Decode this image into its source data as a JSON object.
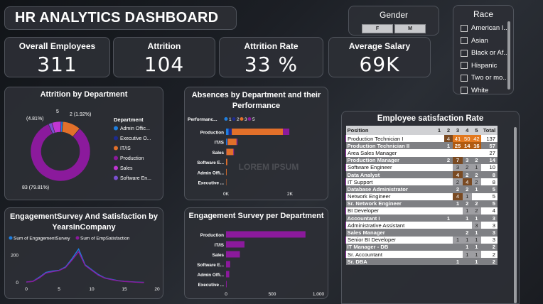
{
  "header": {
    "title": "HR ANALYTICS DASHBOARD"
  },
  "kpis": [
    {
      "label": "Overall Employees",
      "value": "311"
    },
    {
      "label": "Attrition",
      "value": "104"
    },
    {
      "label": "Attrition Rate",
      "value": "33 %"
    },
    {
      "label": "Average Salary",
      "value": "69K"
    }
  ],
  "gender": {
    "title": "Gender",
    "options": [
      "F",
      "M"
    ]
  },
  "race": {
    "title": "Race",
    "options": [
      "American I..",
      "Asian",
      "Black or Af..",
      "Hispanic",
      "Two or mo..",
      "White"
    ]
  },
  "watermark": "LOREM IPSUM",
  "colors": {
    "purple": "#8b1a9c",
    "orange": "#e2702a",
    "blue": "#1f7fe0",
    "darkblue": "#1d2b8f",
    "panel": "#2c2f35",
    "accent_magenta": "#c036d3"
  },
  "chart_data": [
    {
      "type": "pie",
      "title": "Attrition by Department",
      "legend_title": "Department",
      "legend_position": "right",
      "slices": [
        {
          "name": "Admin Offic...",
          "value": 1,
          "color": "#1f7fe0"
        },
        {
          "name": "Executive O...",
          "value": 0,
          "color": "#1d2b8f"
        },
        {
          "name": "IT/IS",
          "value": 10,
          "color": "#e2702a"
        },
        {
          "name": "Production",
          "value": 83,
          "color": "#8b1a9c"
        },
        {
          "name": "Sales",
          "value": 5,
          "color": "#c036d3"
        },
        {
          "name": "Software En...",
          "value": 2,
          "color": "#7b4fd0"
        }
      ],
      "data_labels": [
        "2 (1.92%)",
        "5",
        "(4.81%)",
        "83 (79.81%)"
      ]
    },
    {
      "type": "bar",
      "orientation": "horizontal",
      "title": "Absences by Department and their Performance",
      "legend_title": "Performanc...",
      "legend_position": "top",
      "categories": [
        "Production",
        "IT/IS",
        "Sales",
        "Software E...",
        "Admin Offi...",
        "Executive ..."
      ],
      "series": [
        {
          "name": "1",
          "color": "#1f7fe0",
          "values": [
            80,
            30,
            0,
            0,
            0,
            0
          ]
        },
        {
          "name": "2",
          "color": "#1d2b8f",
          "values": [
            100,
            20,
            10,
            0,
            0,
            0
          ]
        },
        {
          "name": "3",
          "color": "#e2702a",
          "values": [
            1600,
            280,
            220,
            40,
            20,
            10
          ]
        },
        {
          "name": "5",
          "color": "#8b1a9c",
          "values": [
            200,
            30,
            20,
            0,
            0,
            0
          ]
        }
      ],
      "xticks": [
        "0K",
        "2K"
      ],
      "xlim": [
        0,
        2600
      ]
    },
    {
      "type": "line",
      "title": "EngagementSurvey And Satisfaction by YearsInCompany",
      "legend_position": "top-left",
      "x": [
        0,
        1,
        2,
        3,
        4,
        5,
        6,
        7,
        8,
        9,
        10,
        11,
        12,
        13,
        14,
        15,
        16,
        17,
        18
      ],
      "series": [
        {
          "name": "Sum of EngagementSurvey",
          "color": "#1f7fe0",
          "values": [
            5,
            10,
            40,
            75,
            85,
            90,
            115,
            175,
            245,
            130,
            95,
            60,
            35,
            25,
            15,
            10,
            7,
            4,
            2
          ]
        },
        {
          "name": "Sum of EmpSatisfaction",
          "color": "#8b1a9c",
          "values": [
            5,
            9,
            35,
            70,
            80,
            88,
            110,
            165,
            225,
            125,
            90,
            55,
            33,
            22,
            14,
            9,
            6,
            3,
            2
          ]
        }
      ],
      "xticks": [
        0,
        5,
        10,
        15,
        20
      ],
      "yticks": [
        0,
        200
      ],
      "xlim": [
        0,
        20
      ],
      "ylim": [
        0,
        300
      ]
    },
    {
      "type": "bar",
      "orientation": "horizontal",
      "title": "Engagement Survey per Department",
      "categories": [
        "Production",
        "IT/IS",
        "Sales",
        "Software E...",
        "Admin Offi...",
        "Executive ..."
      ],
      "values": [
        860,
        200,
        150,
        45,
        35,
        5
      ],
      "color": "#8b1a9c",
      "xticks": [
        "0",
        "500",
        "1,000"
      ],
      "xlim": [
        0,
        1000
      ]
    },
    {
      "type": "table",
      "title": "Employee satisfaction Rate",
      "columns": [
        "Position",
        "1",
        "2",
        "3",
        "4",
        "5",
        "Total"
      ],
      "rows": [
        {
          "position": "Production Technician I",
          "cells": [
            "",
            "",
            "4",
            "41",
            "50",
            "42"
          ],
          "total": "137",
          "style": "a"
        },
        {
          "position": "Production Technician II",
          "cells": [
            "",
            "",
            "1",
            "25",
            "14",
            "16"
          ],
          "total": "57",
          "style": "b"
        },
        {
          "position": "Area Sales Manager",
          "cells": [
            "",
            "",
            "",
            "",
            "",
            ""
          ],
          "total": "27",
          "style": "a"
        },
        {
          "position": "Production Manager",
          "cells": [
            "",
            "",
            "2",
            "7",
            "3",
            "2"
          ],
          "total": "14",
          "style": "b"
        },
        {
          "position": "Software Engineer",
          "cells": [
            "",
            "",
            "",
            "3",
            "2",
            "1"
          ],
          "total": "10",
          "style": "a"
        },
        {
          "position": "Data Analyst",
          "cells": [
            "",
            "",
            "",
            "4",
            "2",
            "2"
          ],
          "total": "8",
          "style": "b"
        },
        {
          "position": "IT Support",
          "cells": [
            "",
            "",
            "",
            "2",
            "4",
            "2"
          ],
          "total": "8",
          "style": "a"
        },
        {
          "position": "Database Administrator",
          "cells": [
            "",
            "",
            "",
            "2",
            "2",
            "1"
          ],
          "total": "5",
          "style": "b"
        },
        {
          "position": "Network Engineer",
          "cells": [
            "",
            "",
            "",
            "4",
            "1",
            ""
          ],
          "total": "5",
          "style": "a"
        },
        {
          "position": "Sr. Network Engineer",
          "cells": [
            "",
            "",
            "",
            "1",
            "2",
            "2"
          ],
          "total": "5",
          "style": "b"
        },
        {
          "position": "BI Developer",
          "cells": [
            "",
            "",
            "",
            "",
            "1",
            "2"
          ],
          "total": "4",
          "style": "a"
        },
        {
          "position": "Accountant I",
          "cells": [
            "",
            "",
            "1",
            "",
            "1",
            "1"
          ],
          "total": "3",
          "style": "b"
        },
        {
          "position": "Administrative Assistant",
          "cells": [
            "",
            "",
            "",
            "",
            "",
            "3"
          ],
          "total": "3",
          "style": "a"
        },
        {
          "position": "Sales Manager",
          "cells": [
            "",
            "",
            "",
            "",
            "2",
            "1"
          ],
          "total": "3",
          "style": "b"
        },
        {
          "position": "Senior BI Developer",
          "cells": [
            "",
            "",
            "",
            "1",
            "1",
            "1"
          ],
          "total": "3",
          "style": "a"
        },
        {
          "position": "IT Manager - DB",
          "cells": [
            "",
            "",
            "",
            "",
            "1",
            "1"
          ],
          "total": "2",
          "style": "b"
        },
        {
          "position": "Sr. Accountant",
          "cells": [
            "",
            "",
            "",
            "",
            "1",
            "1"
          ],
          "total": "2",
          "style": "a"
        },
        {
          "position": "Sr. DBA",
          "cells": [
            "",
            "",
            "",
            "1",
            "",
            "1"
          ],
          "total": "2",
          "style": "b"
        }
      ]
    }
  ]
}
